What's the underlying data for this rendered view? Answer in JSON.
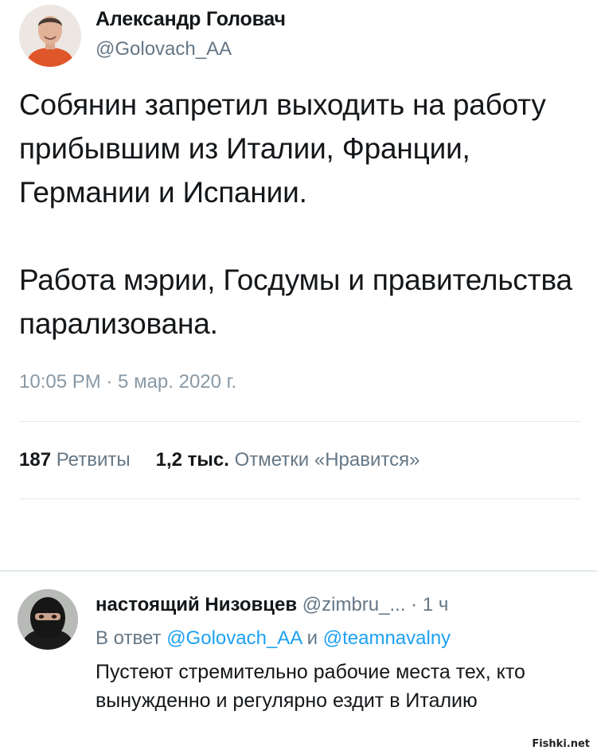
{
  "tweet": {
    "author_name": "Александр Головач",
    "author_handle": "@Golovach_AA",
    "text": "Собянин запретил выходить на работу прибывшим из Италии, Франции, Германии и Испании.\n\nРабота мэрии, Госдумы и правительства парализована.",
    "timestamp": "10:05 PM · 5 мар. 2020 г.",
    "retweets_count": "187",
    "retweets_label": "Ретвиты",
    "likes_count": "1,2 тыс.",
    "likes_label": "Отметки «Нравится»",
    "avatar_icon": "person-avatar-icon"
  },
  "reply": {
    "author_name": "настоящий Низовцев",
    "author_handle": "@zimbru_...",
    "separator": "·",
    "time": "1 ч",
    "in_reply_to_label": "В ответ",
    "mention_1": "@Golovach_AA",
    "conjunction": "и",
    "mention_2": "@teamnavalny",
    "text": "Пустеют стремительно рабочие места тех, кто вынужденно и регулярно ездит в Италию",
    "avatar_icon": "masked-person-avatar-icon"
  },
  "watermark": "Fishki.net",
  "colors": {
    "text": "#14171a",
    "secondary": "#657786",
    "timestamp": "#8899a6",
    "link": "#1da1f2",
    "divider": "#e1e8ed"
  }
}
